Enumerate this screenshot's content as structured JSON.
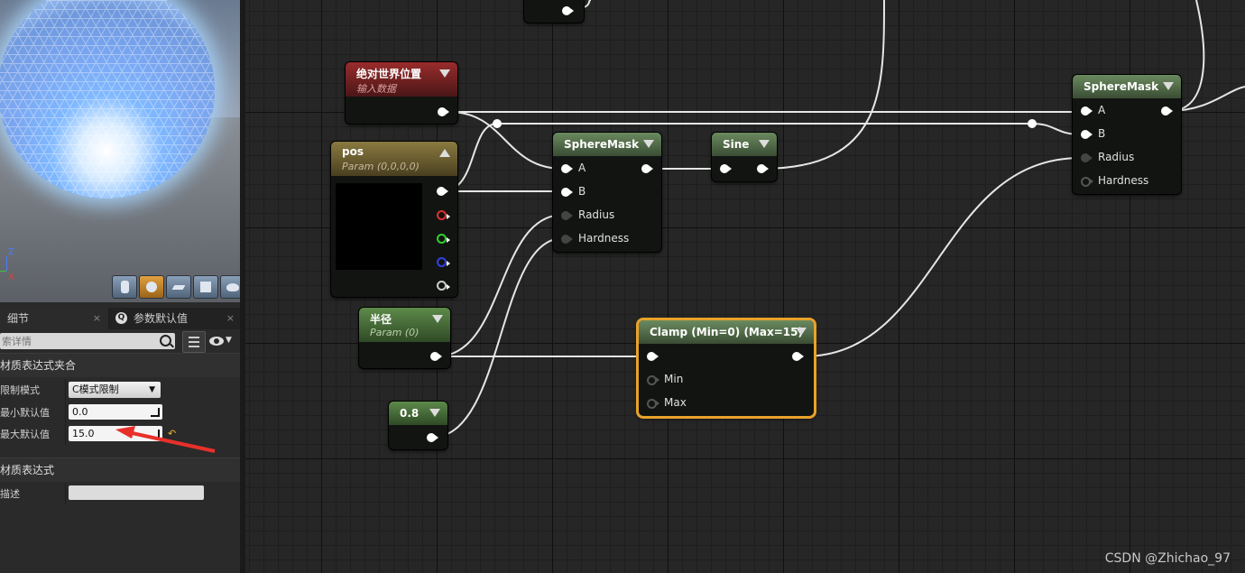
{
  "viewport": {
    "axis_z": "Z",
    "axis_x": "X",
    "buttons": [
      "cylinder-icon",
      "sphere-icon",
      "plane-icon",
      "cube-icon",
      "teapot-icon"
    ]
  },
  "tabs": {
    "details": "细节",
    "params": "参数默认值",
    "close": "×"
  },
  "search": {
    "placeholder": "索详情"
  },
  "details": {
    "section1": "材质表达式夹合",
    "clamp_mode_label": "限制模式",
    "clamp_mode_value": "C模式限制",
    "min_default_label": "最小默认值",
    "min_default_value": "0.0",
    "max_default_label": "最大默认值",
    "max_default_value": "15.0",
    "section2": "材质表达式",
    "desc_label": "描述"
  },
  "nodes": {
    "world_pos": {
      "title": "绝对世界位置",
      "subtitle": "输入数据"
    },
    "pos": {
      "title": "pos",
      "subtitle": "Param (0,0,0,0)"
    },
    "radius_param": {
      "title": "半径",
      "subtitle": "Param (0)"
    },
    "constant": {
      "title": "0.8"
    },
    "spheremask1": {
      "title": "SphereMask",
      "pins": [
        "A",
        "B",
        "Radius",
        "Hardness"
      ]
    },
    "sine": {
      "title": "Sine"
    },
    "spheremask2": {
      "title": "SphereMask",
      "pins": [
        "A",
        "B",
        "Radius",
        "Hardness"
      ]
    },
    "clamp": {
      "title": "Clamp (Min=0) (Max=15)",
      "pins": [
        "Min",
        "Max"
      ]
    }
  },
  "colors": {
    "selection": "#e8a22a",
    "arrow": "#e8302a"
  },
  "watermark": "CSDN @Zhichao_97"
}
